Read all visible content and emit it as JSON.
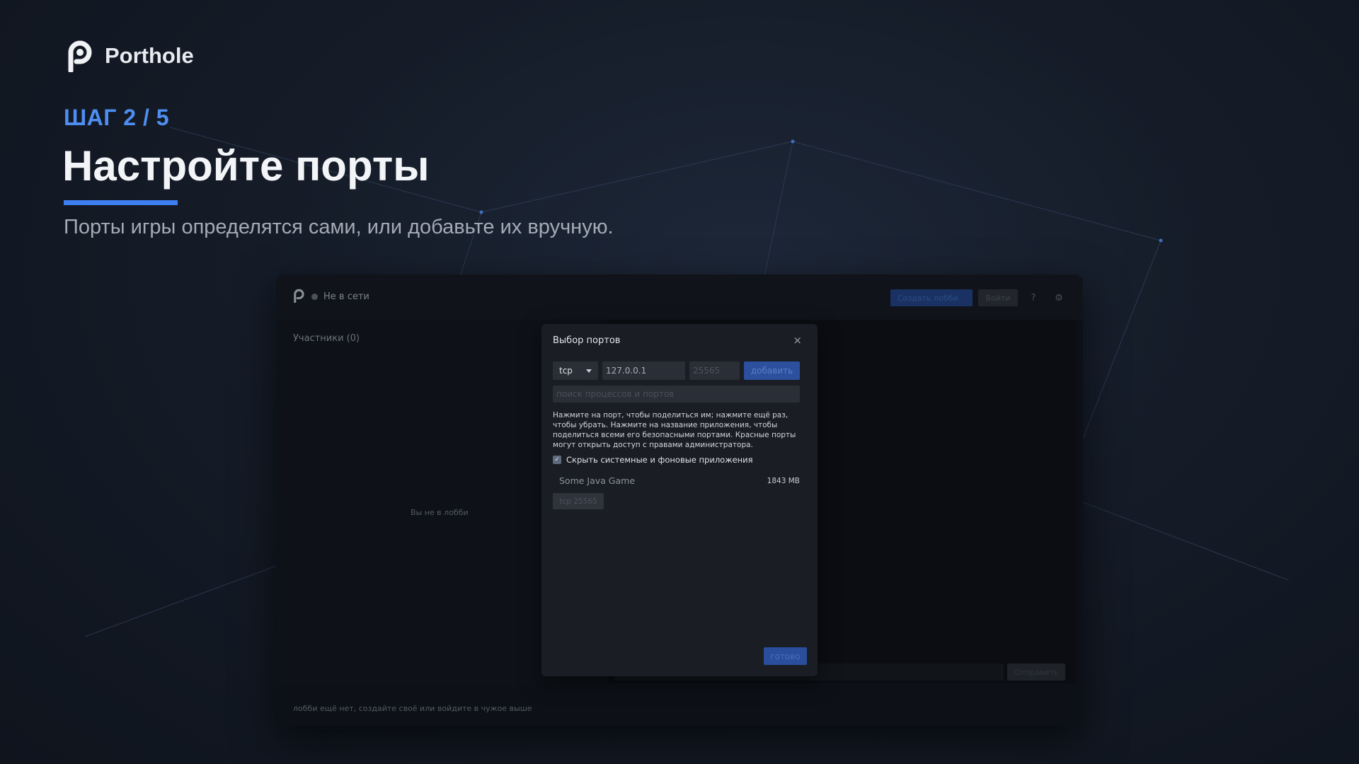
{
  "brand": {
    "name": "Porthole",
    "logo_icon": "porthole-p-logo"
  },
  "hero": {
    "step": "ШАГ 2 / 5",
    "title": "Настройте порты",
    "subtitle": "Порты игры определятся сами, или добавьте их вручную."
  },
  "colors": {
    "accent": "#3d7ff0",
    "step_text": "#4e8ef2",
    "background": "#151c28",
    "primary_button": "#2c4f9e"
  },
  "app": {
    "status": "Не в сети",
    "top": {
      "create_label": "Создать лобби",
      "join_label": "Войти",
      "help_icon": "?",
      "settings_icon": "⚙"
    },
    "sidebar": {
      "participants_label": "Участники (0)",
      "empty_text": "Вы не в лобби"
    },
    "chat": {
      "send_label": "Отправить"
    },
    "bottom_hint": "лобби ещё нет, создайте своё или войдите в чужое выше"
  },
  "dialog": {
    "title": "Выбор портов",
    "close_icon": "×",
    "protocol": "tcp",
    "ip_value": "127.0.0.1",
    "port_placeholder": "25565",
    "add_label": "добавить",
    "search_placeholder": "поиск процессов и портов",
    "help_text": "Нажмите на порт, чтобы поделиться им; нажмите ещё раз, чтобы убрать. Нажмите на название приложения, чтобы поделиться всеми его безопасными портами. Красные порты могут открыть доступ с правами администратора.",
    "hide_checkbox": {
      "label": "Скрыть системные и фоновые приложения",
      "checked": true
    },
    "apps": [
      {
        "name": "Some Java Game",
        "memory": "1843 MB",
        "ports": [
          "tcp 25565"
        ]
      }
    ],
    "done_label": "готово"
  }
}
